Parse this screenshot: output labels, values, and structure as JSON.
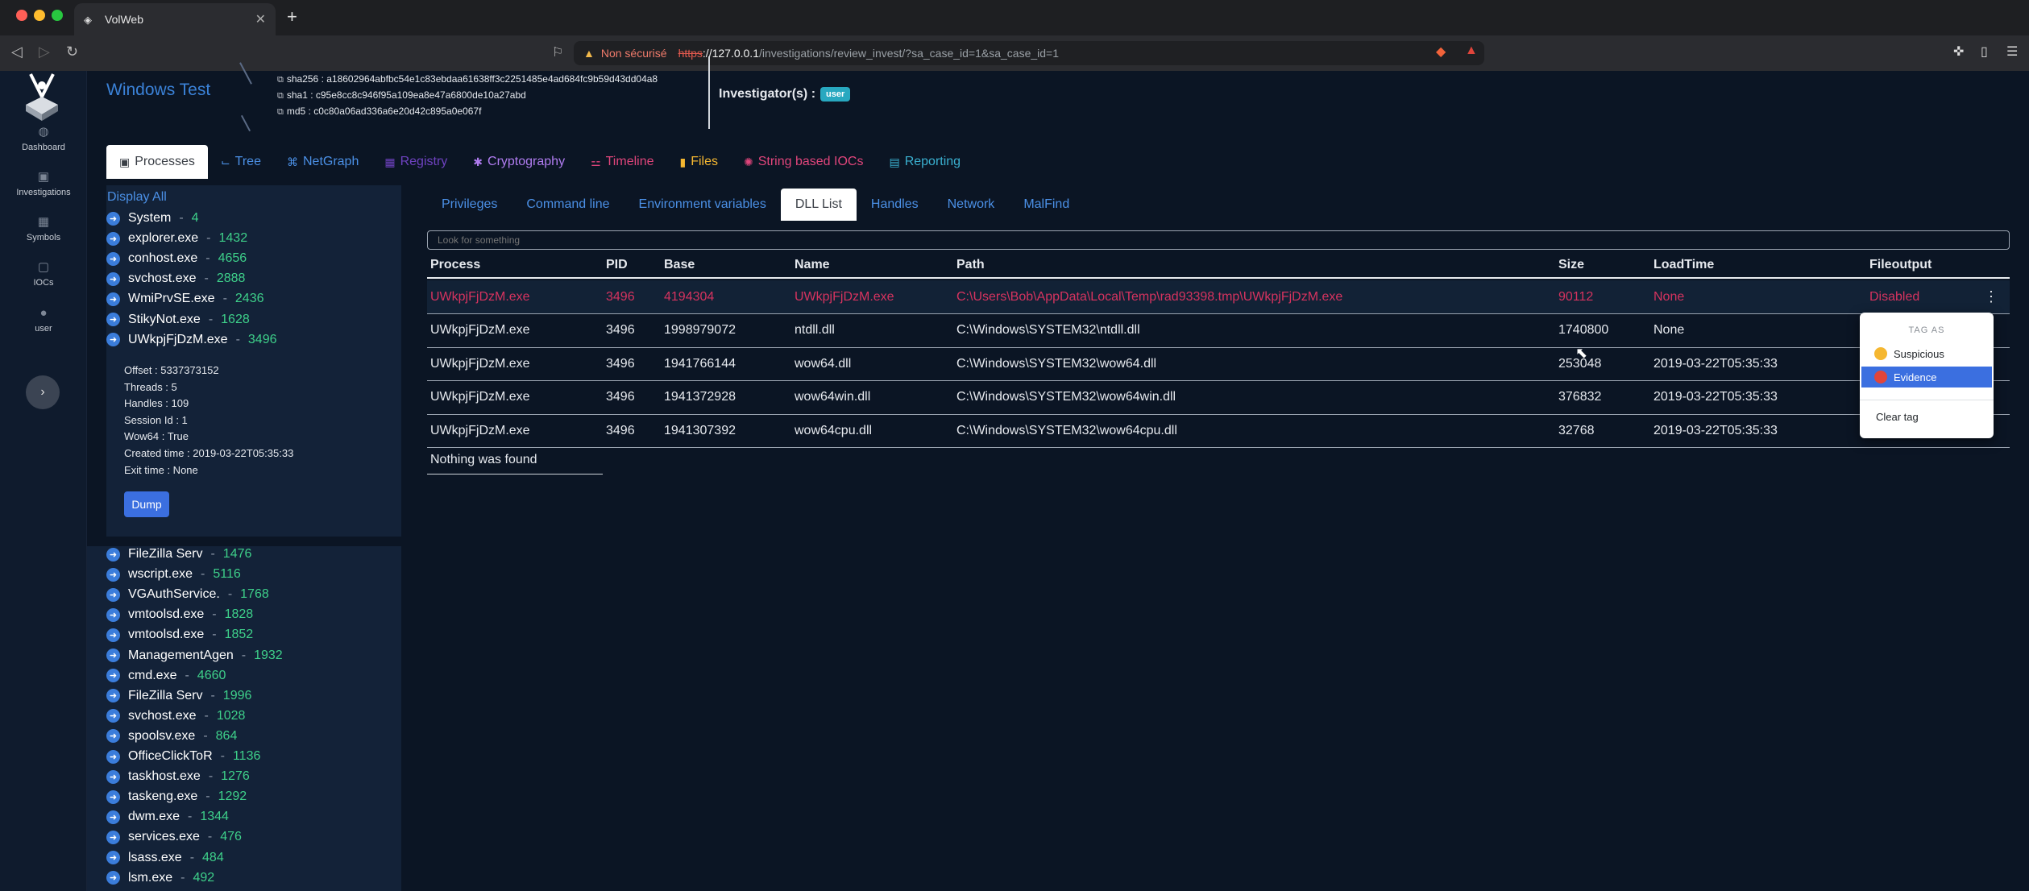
{
  "browser": {
    "tab_title": "VolWeb",
    "tab_close": "✕",
    "new_tab": "+",
    "url_warning": "Non sécurisé",
    "url_scheme": "https",
    "url_host": "://127.0.0.1",
    "url_path": "/investigations/review_invest/?sa_case_id=1&sa_case_id=1"
  },
  "rail": {
    "items": [
      {
        "label": "Dashboard"
      },
      {
        "label": "Investigations"
      },
      {
        "label": "Symbols"
      },
      {
        "label": "IOCs"
      },
      {
        "label": "user"
      }
    ]
  },
  "header": {
    "case_title": "Windows Test",
    "sha256": "sha256 : a18602964abfbc54e1c83ebdaa61638ff3c2251485e4ad684fc9b59d43dd04a8",
    "sha1": "sha1 : c95e8cc8c946f95a109ea8e47a6800de10a27abd",
    "md5": "md5 : c0c80a06ad336a6e20d42c895a0e067f",
    "investigators_label": "Investigator(s) :",
    "investigator_badge": "user"
  },
  "main_tabs": [
    {
      "label": "Processes",
      "icon": "▣",
      "color": "#3a3f46"
    },
    {
      "label": "Tree",
      "icon": "⌙",
      "color": "#4b90e6"
    },
    {
      "label": "NetGraph",
      "icon": "⌘",
      "color": "#4b90e6"
    },
    {
      "label": "Registry",
      "icon": "▦",
      "color": "#6f42c1"
    },
    {
      "label": "Cryptography",
      "icon": "✱",
      "color": "#b07cf0"
    },
    {
      "label": "Timeline",
      "icon": "⚍",
      "color": "#e0457b"
    },
    {
      "label": "Files",
      "icon": "▮",
      "color": "#f5b731"
    },
    {
      "label": "String based IOCs",
      "icon": "✺",
      "color": "#e0457b"
    },
    {
      "label": "Reporting",
      "icon": "▤",
      "color": "#3ab0d0"
    }
  ],
  "sidebar": {
    "display_all": "Display All",
    "separator": "-",
    "processes_top": [
      {
        "name": "System",
        "pid": "4"
      },
      {
        "name": "explorer.exe",
        "pid": "1432"
      },
      {
        "name": "conhost.exe",
        "pid": "4656"
      },
      {
        "name": "svchost.exe",
        "pid": "2888"
      },
      {
        "name": "WmiPrvSE.exe",
        "pid": "2436"
      },
      {
        "name": "StikyNot.exe",
        "pid": "1628"
      },
      {
        "name": "UWkpjFjDzM.exe",
        "pid": "3496"
      }
    ],
    "details": {
      "offset": "Offset : 5337373152",
      "threads": "Threads : 5",
      "handles": "Handles : 109",
      "session": "Session Id : 1",
      "wow64": "Wow64 : True",
      "created": "Created time : 2019-03-22T05:35:33",
      "exit": "Exit time : None"
    },
    "dump_label": "Dump",
    "processes_bottom": [
      {
        "name": "FileZilla Serv",
        "pid": "1476"
      },
      {
        "name": "wscript.exe",
        "pid": "5116"
      },
      {
        "name": "VGAuthService.",
        "pid": "1768"
      },
      {
        "name": "vmtoolsd.exe",
        "pid": "1828"
      },
      {
        "name": "vmtoolsd.exe",
        "pid": "1852"
      },
      {
        "name": "ManagementAgen",
        "pid": "1932"
      },
      {
        "name": "cmd.exe",
        "pid": "4660"
      },
      {
        "name": "FileZilla Serv",
        "pid": "1996"
      },
      {
        "name": "svchost.exe",
        "pid": "1028"
      },
      {
        "name": "spoolsv.exe",
        "pid": "864"
      },
      {
        "name": "OfficeClickToR",
        "pid": "1136"
      },
      {
        "name": "taskhost.exe",
        "pid": "1276"
      },
      {
        "name": "taskeng.exe",
        "pid": "1292"
      },
      {
        "name": "dwm.exe",
        "pid": "1344"
      },
      {
        "name": "services.exe",
        "pid": "476"
      },
      {
        "name": "lsass.exe",
        "pid": "484"
      },
      {
        "name": "lsm.exe",
        "pid": "492"
      }
    ]
  },
  "sub_tabs": [
    "Privileges",
    "Command line",
    "Environment variables",
    "DLL List",
    "Handles",
    "Network",
    "MalFind"
  ],
  "active_sub_tab": "DLL List",
  "search": {
    "placeholder": "Look for something"
  },
  "table": {
    "columns": [
      "Process",
      "PID",
      "Base",
      "Name",
      "Path",
      "Size",
      "LoadTime",
      "Fileoutput"
    ],
    "rows": [
      [
        "UWkpjFjDzM.exe",
        "3496",
        "4194304",
        "UWkpjFjDzM.exe",
        "C:\\Users\\Bob\\AppData\\Local\\Temp\\rad93398.tmp\\UWkpjFjDzM.exe",
        "90112",
        "None",
        "Disabled"
      ],
      [
        "UWkpjFjDzM.exe",
        "3496",
        "1998979072",
        "ntdll.dll",
        "C:\\Windows\\SYSTEM32\\ntdll.dll",
        "1740800",
        "None",
        ""
      ],
      [
        "UWkpjFjDzM.exe",
        "3496",
        "1941766144",
        "wow64.dll",
        "C:\\Windows\\SYSTEM32\\wow64.dll",
        "253048",
        "2019-03-22T05:35:33",
        ""
      ],
      [
        "UWkpjFjDzM.exe",
        "3496",
        "1941372928",
        "wow64win.dll",
        "C:\\Windows\\SYSTEM32\\wow64win.dll",
        "376832",
        "2019-03-22T05:35:33",
        ""
      ],
      [
        "UWkpjFjDzM.exe",
        "3496",
        "1941307392",
        "wow64cpu.dll",
        "C:\\Windows\\SYSTEM32\\wow64cpu.dll",
        "32768",
        "2019-03-22T05:35:33",
        ""
      ]
    ],
    "footer": "Nothing was found",
    "kebab": "⋮"
  },
  "tag_menu": {
    "header": "TAG AS",
    "suspicious": "Suspicious",
    "evidence": "Evidence",
    "clear": "Clear tag",
    "suspicious_color": "#f5b731",
    "evidence_color": "#e0453b"
  }
}
